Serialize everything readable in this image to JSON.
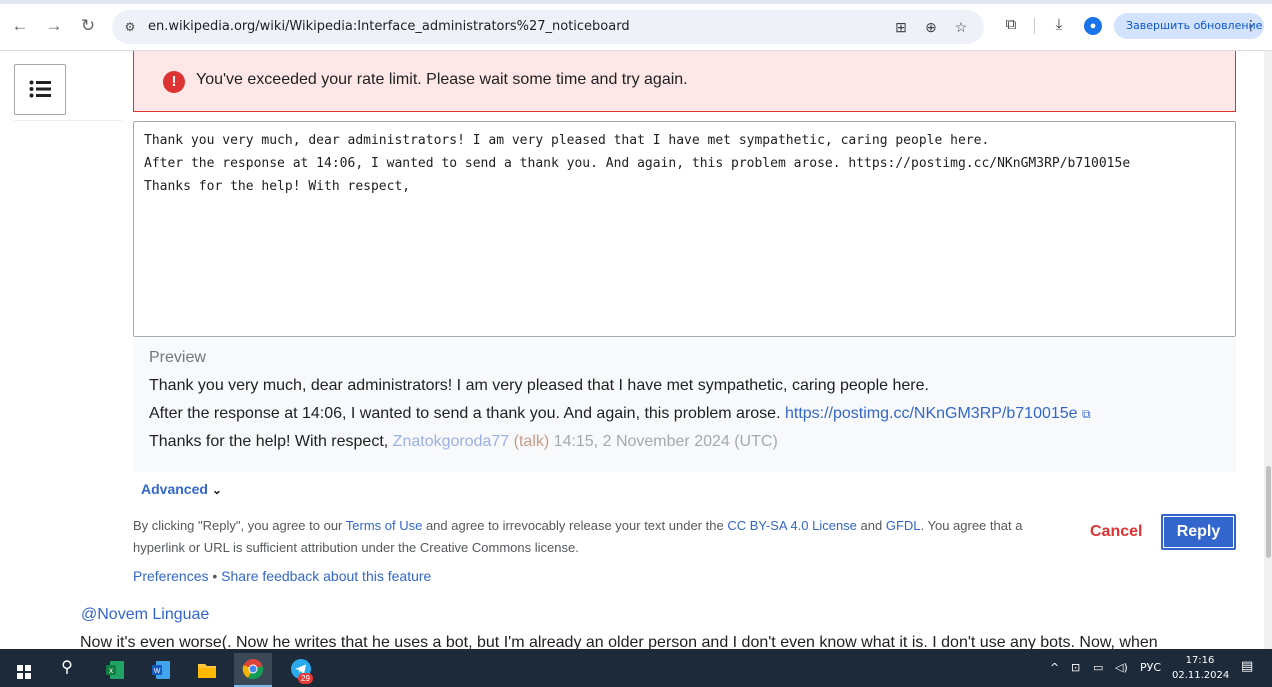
{
  "browser": {
    "url": "en.wikipedia.org/wiki/Wikipedia:Interface_administrators%27_noticeboard",
    "update_label": "Завершить обновление",
    "icons": [
      "back-icon",
      "forward-icon",
      "reload-icon",
      "site-info-icon",
      "translate-icon",
      "zoom-icon",
      "bookmark-star-icon",
      "extensions-icon",
      "download-icon",
      "profile-icon",
      "menu-icon"
    ]
  },
  "error": {
    "message": "You've exceeded your rate limit. Please wait some time and try again."
  },
  "editor": {
    "lines": [
      "Thank you very much, dear administrators! I am very pleased that I have met sympathetic, caring people here.",
      "After the response at 14:06, I wanted to send a thank you. And again, this problem arose. https://postimg.cc/NKnGM3RP/b710015e",
      "Thanks for the help! With respect,"
    ]
  },
  "preview": {
    "label": "Preview",
    "line1": "Thank you very much, dear administrators! I am very pleased that I have met sympathetic, caring people here.",
    "line2_text": "After the response at 14:06, I wanted to send a thank you. And again, this problem arose. ",
    "line2_link": "https://postimg.cc/NKnGM3RP/b710015e",
    "line3_text": "Thanks for the help! With respect, ",
    "sig_user": "Znatokgoroda77",
    "sig_open": " (",
    "sig_talk": "talk",
    "sig_close": ")",
    "sig_date": " 14:15, 2 November 2024 (UTC)"
  },
  "advanced": {
    "label": "Advanced"
  },
  "legal": {
    "t1": "By clicking \"Reply\", you agree to our ",
    "terms": "Terms of Use",
    "t2": " and agree to irrevocably release your text under the ",
    "license": "CC BY-SA 4.0 License",
    "t3": " and ",
    "gfdl": "GFDL",
    "t4": ". You agree that a hyperlink or URL is sufficient attribution under the Creative Commons license."
  },
  "actions": {
    "cancel": "Cancel",
    "reply": "Reply"
  },
  "footer_links": {
    "preferences": "Preferences",
    "sep": " • ",
    "feedback": "Share feedback about this feature"
  },
  "thread": {
    "mention": "@Novem Linguae",
    "next_comment": "Now it's even worse(. Now he writes that he uses a bot, but I'm already an older person and I don't even know what it is. I don't use any bots. Now, when"
  },
  "taskbar": {
    "telegram_badge": "29",
    "lang": "РУС",
    "time": "17:16",
    "date": "02.11.2024"
  }
}
